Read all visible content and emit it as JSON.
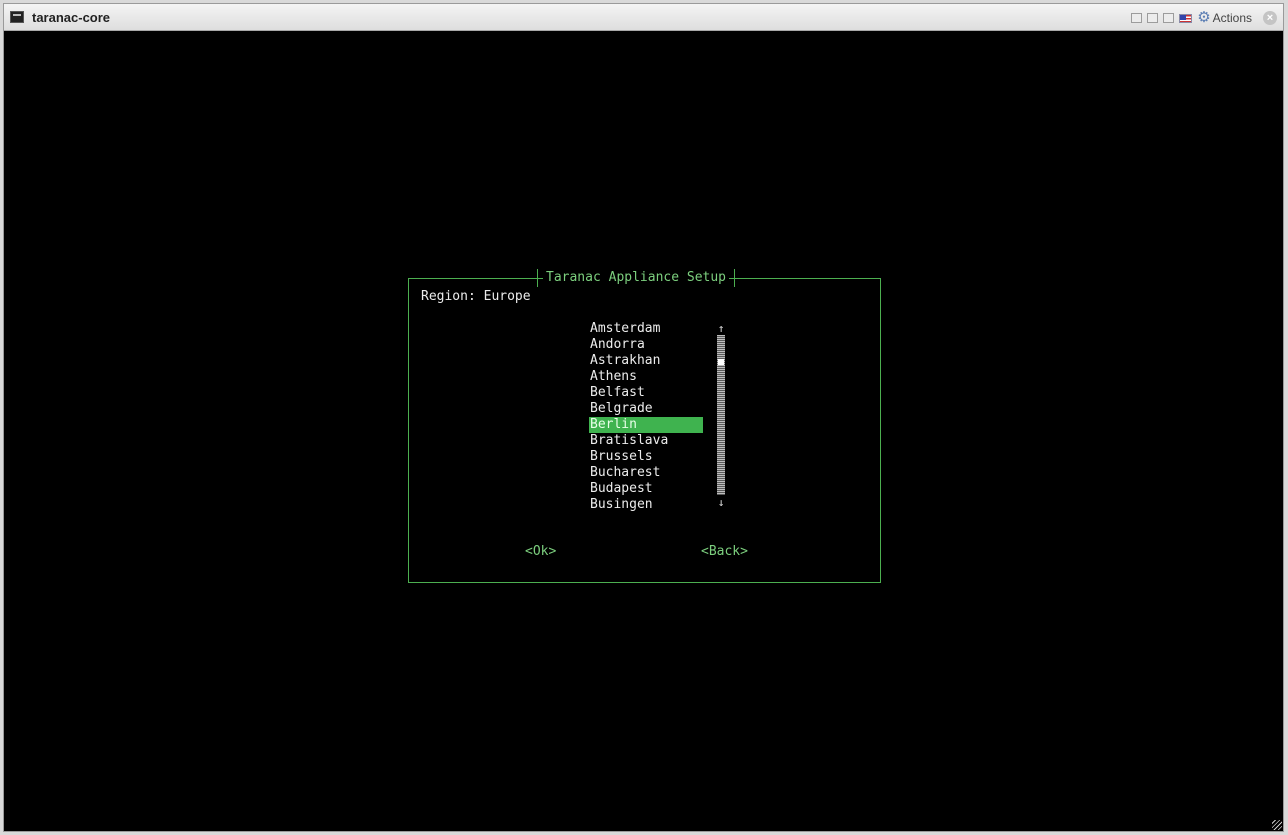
{
  "window": {
    "title": "taranac-core",
    "actions_label": "Actions",
    "icons": [
      "terminal-icon",
      "minimize-icon",
      "restore-icon",
      "maximize-icon",
      "flag-icon",
      "gear-icon",
      "close-icon"
    ]
  },
  "dialog": {
    "title": "Taranac Appliance Setup",
    "region_line": "Region: Europe",
    "items": [
      {
        "label": "Amsterdam"
      },
      {
        "label": "Andorra"
      },
      {
        "label": "Astrakhan"
      },
      {
        "label": "Athens"
      },
      {
        "label": "Belfast"
      },
      {
        "label": "Belgrade"
      },
      {
        "label": "Berlin",
        "selected": true
      },
      {
        "label": "Bratislava"
      },
      {
        "label": "Brussels"
      },
      {
        "label": "Bucharest"
      },
      {
        "label": "Budapest"
      },
      {
        "label": "Busingen"
      }
    ],
    "selected_index": 6,
    "ok_label": "<Ok>",
    "back_label": "<Back>",
    "accent_color": "#3fb34f",
    "border_color": "#4caf50"
  }
}
